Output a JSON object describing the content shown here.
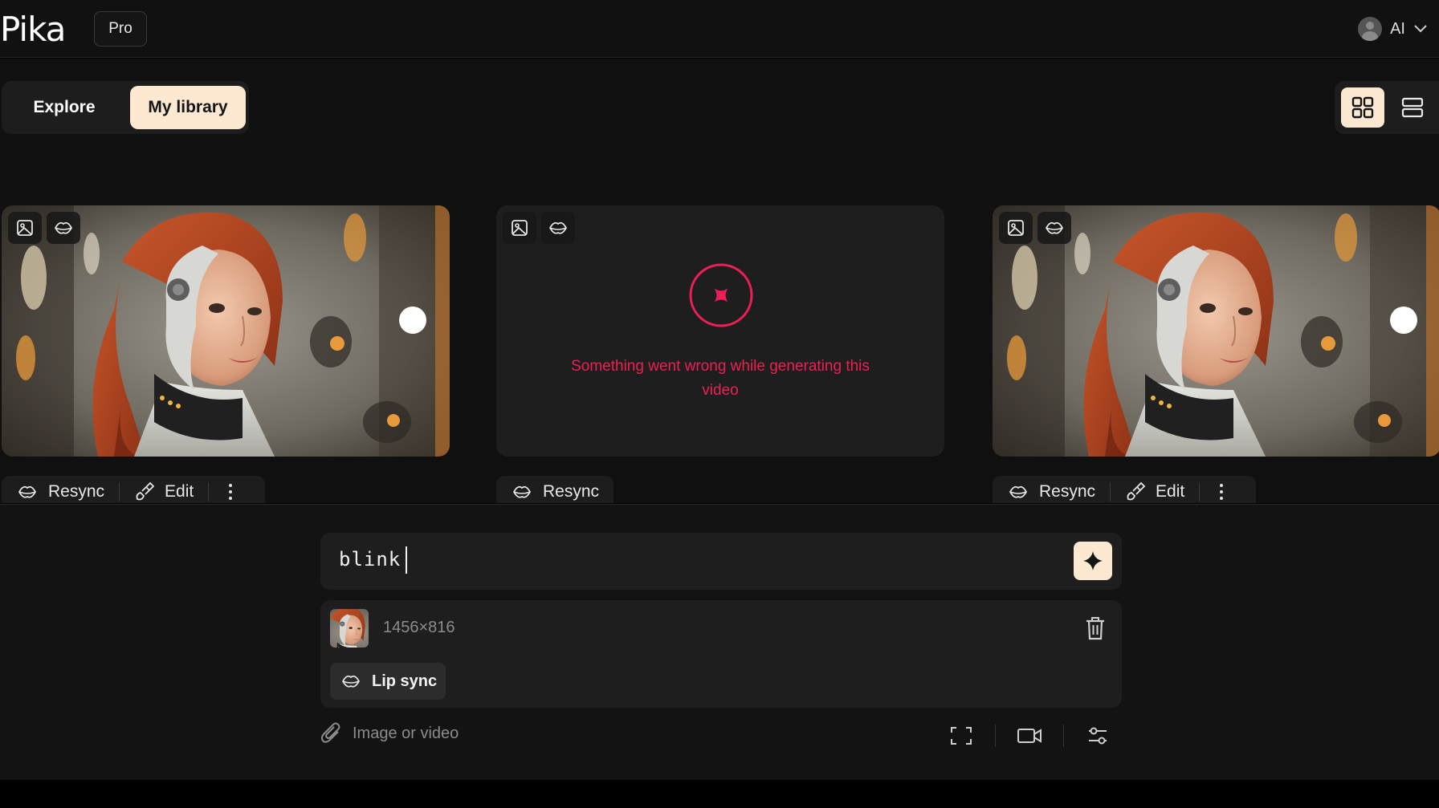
{
  "header": {
    "logo": "Pika",
    "plan_badge": "Pro",
    "user_name": "AI"
  },
  "nav": {
    "tabs": [
      {
        "label": "Explore",
        "active": false
      },
      {
        "label": "My library",
        "active": true
      }
    ],
    "view_modes": [
      "grid-view-icon",
      "list-view-icon"
    ],
    "active_view": "grid"
  },
  "cards": [
    {
      "status": "done",
      "badges": [
        "image-icon",
        "lips-icon"
      ],
      "actions": {
        "resync": "Resync",
        "edit": "Edit"
      }
    },
    {
      "status": "error",
      "badges": [
        "image-icon",
        "lips-icon"
      ],
      "error_message": "Something went wrong while generating this video",
      "actions": {
        "resync": "Resync"
      }
    },
    {
      "status": "done",
      "badges": [
        "image-icon",
        "lips-icon"
      ],
      "actions": {
        "resync": "Resync",
        "edit": "Edit"
      }
    }
  ],
  "composer": {
    "prompt_value": "blink",
    "attachment": {
      "dimensions": "1456×816",
      "mode_chip": "Lip sync"
    },
    "attach_placeholder": "Image or video",
    "tool_icons": [
      "expand-frame-icon",
      "video-camera-icon",
      "settings-sliders-icon"
    ]
  },
  "colors": {
    "accent": "#fde9d2",
    "error": "#ee1f54",
    "background": "#101010",
    "panel": "#1e1e1e"
  }
}
